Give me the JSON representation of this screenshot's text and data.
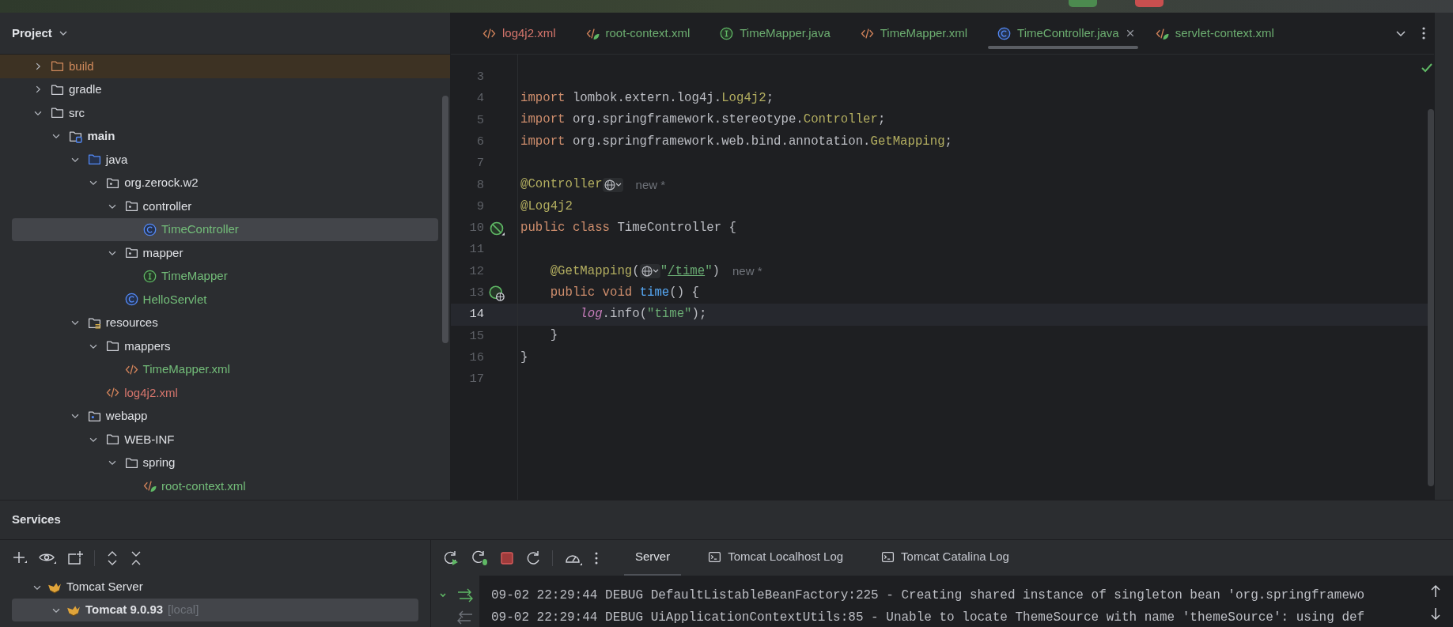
{
  "toolbar_buttons": [
    {
      "kind": "run"
    },
    {
      "kind": "stop"
    }
  ],
  "project": {
    "title": "Project",
    "tree": [
      {
        "label": "build",
        "kind": "excluded",
        "color": "#d08a5c",
        "expanded": false,
        "selected": false
      },
      {
        "label": "gradle",
        "kind": "folder",
        "color": "#dfe1e5",
        "expanded": false,
        "selected": false
      },
      {
        "label": "src",
        "kind": "folder",
        "color": "#dfe1e5",
        "expanded": true,
        "selected": false,
        "children": [
          {
            "label": "main",
            "kind": "module-root",
            "color": "#dfe1e5",
            "expanded": true,
            "selected": false,
            "children": [
              {
                "label": "java",
                "kind": "source-root",
                "color": "#dfe1e5",
                "expanded": true,
                "selected": false,
                "children": [
                  {
                    "label": "org.zerock.w2",
                    "kind": "package",
                    "color": "#dfe1e5",
                    "expanded": true,
                    "selected": false,
                    "children": [
                      {
                        "label": "controller",
                        "kind": "package",
                        "color": "#dfe1e5",
                        "expanded": true,
                        "selected": false,
                        "children": [
                          {
                            "label": "TimeController",
                            "kind": "class",
                            "color": "#73bd79",
                            "selected": true
                          }
                        ]
                      },
                      {
                        "label": "mapper",
                        "kind": "package",
                        "color": "#dfe1e5",
                        "expanded": true,
                        "selected": false,
                        "children": [
                          {
                            "label": "TimeMapper",
                            "kind": "interface",
                            "color": "#73bd79",
                            "selected": false
                          }
                        ]
                      },
                      {
                        "label": "HelloServlet",
                        "kind": "class",
                        "color": "#73bd79",
                        "selected": false
                      }
                    ]
                  }
                ]
              },
              {
                "label": "resources",
                "kind": "resources",
                "color": "#dfe1e5",
                "expanded": true,
                "selected": false,
                "children": [
                  {
                    "label": "mappers",
                    "kind": "folder",
                    "color": "#dfe1e5",
                    "expanded": true,
                    "selected": false,
                    "children": [
                      {
                        "label": "TimeMapper.xml",
                        "kind": "xml",
                        "color": "#73bd79",
                        "selected": false
                      }
                    ]
                  },
                  {
                    "label": "log4j2.xml",
                    "kind": "xml",
                    "color": "#d5756c",
                    "selected": false
                  }
                ]
              },
              {
                "label": "webapp",
                "kind": "webapp",
                "color": "#dfe1e5",
                "expanded": true,
                "selected": false,
                "children": [
                  {
                    "label": "WEB-INF",
                    "kind": "folder",
                    "color": "#dfe1e5",
                    "expanded": true,
                    "selected": false,
                    "children": [
                      {
                        "label": "spring",
                        "kind": "folder",
                        "color": "#dfe1e5",
                        "expanded": true,
                        "selected": false,
                        "children": [
                          {
                            "label": "root-context.xml",
                            "kind": "spring-xml",
                            "color": "#73bd79",
                            "selected": false
                          }
                        ]
                      }
                    ]
                  }
                ]
              }
            ]
          }
        ]
      }
    ]
  },
  "editor": {
    "tabs": [
      {
        "label": "log4j2.xml",
        "kind": "xml",
        "color": "#d5756c",
        "selected": false
      },
      {
        "label": "root-context.xml",
        "kind": "spring-xml",
        "color": "#6cad70",
        "selected": false
      },
      {
        "label": "TimeMapper.java",
        "kind": "interface",
        "color": "#6cad70",
        "selected": false
      },
      {
        "label": "TimeMapper.xml",
        "kind": "xml",
        "color": "#6cad70",
        "selected": false
      },
      {
        "label": "TimeController.java",
        "kind": "class",
        "color": "#6cad70",
        "selected": true
      },
      {
        "label": "servlet-context.xml",
        "kind": "spring-xml",
        "color": "#6cad70",
        "selected": false
      }
    ],
    "lines": [
      {
        "number": "3",
        "current": false
      },
      {
        "number": "4",
        "current": false,
        "segments": [
          {
            "kind": "keyword",
            "text": "import"
          },
          {
            "kind": "plain",
            "text": " lombok.extern.log4j."
          },
          {
            "kind": "type",
            "text": "Log4j2"
          },
          {
            "kind": "plain",
            "text": ";"
          }
        ]
      },
      {
        "number": "5",
        "current": false,
        "segments": [
          {
            "kind": "keyword",
            "text": "import"
          },
          {
            "kind": "plain",
            "text": " org.springframework.stereotype."
          },
          {
            "kind": "type",
            "text": "Controller"
          },
          {
            "kind": "plain",
            "text": ";"
          }
        ]
      },
      {
        "number": "6",
        "current": false,
        "segments": [
          {
            "kind": "keyword",
            "text": "import"
          },
          {
            "kind": "plain",
            "text": " org.springframework.web.bind.annotation."
          },
          {
            "kind": "type",
            "text": "GetMapping"
          },
          {
            "kind": "plain",
            "text": ";"
          }
        ]
      },
      {
        "number": "7",
        "current": false
      },
      {
        "number": "8",
        "current": false,
        "segments": [
          {
            "kind": "annotation",
            "text": "@Controller"
          },
          {
            "kind": "globe"
          },
          {
            "kind": "hint",
            "text": "new *"
          }
        ]
      },
      {
        "number": "9",
        "current": false,
        "segments": [
          {
            "kind": "annotation",
            "text": "@Log4j2"
          }
        ]
      },
      {
        "number": "10",
        "current": false,
        "gutter": {
          "kind": "bean"
        },
        "segments": [
          {
            "kind": "keyword",
            "text": "public class"
          },
          {
            "kind": "plain",
            "text": " TimeController {"
          }
        ]
      },
      {
        "number": "11",
        "current": false
      },
      {
        "number": "12",
        "current": false,
        "segments": [
          {
            "kind": "annotation",
            "text": "    @GetMapping"
          },
          {
            "kind": "plain",
            "text": "("
          },
          {
            "kind": "globe"
          },
          {
            "kind": "string",
            "text": "\""
          },
          {
            "kind": "url",
            "text": "/time"
          },
          {
            "kind": "string",
            "text": "\""
          },
          {
            "kind": "plain",
            "text": ")"
          },
          {
            "kind": "hint",
            "text": "new *"
          }
        ]
      },
      {
        "number": "13",
        "current": false,
        "gutter": {
          "kind": "web-bean"
        },
        "segments": [
          {
            "kind": "keyword",
            "text": "    public void"
          },
          {
            "kind": "method",
            "text": " time"
          },
          {
            "kind": "plain",
            "text": "() {"
          }
        ]
      },
      {
        "number": "14",
        "current": true,
        "segments": [
          {
            "kind": "field",
            "text": "        log"
          },
          {
            "kind": "plain",
            "text": ".info("
          },
          {
            "kind": "string",
            "text": "\"time\""
          },
          {
            "kind": "plain",
            "text": ");"
          }
        ]
      },
      {
        "number": "15",
        "current": false,
        "segments": [
          {
            "kind": "plain",
            "text": "    }"
          }
        ]
      },
      {
        "number": "16",
        "current": false,
        "segments": [
          {
            "kind": "plain",
            "text": "}"
          }
        ]
      },
      {
        "number": "17",
        "current": false
      }
    ]
  },
  "services": {
    "title": "Services",
    "tree": [
      {
        "label": "Tomcat Server",
        "expanded": true,
        "selected": false,
        "children": [
          {
            "label": "Tomcat 9.0.93",
            "note": "[local]",
            "expanded": true,
            "selected": true
          }
        ]
      }
    ],
    "tabs": [
      {
        "label": "Server",
        "kind": "plain",
        "selected": true
      },
      {
        "label": "Tomcat Localhost Log",
        "kind": "log",
        "selected": false
      },
      {
        "label": "Tomcat Catalina Log",
        "kind": "log",
        "selected": false
      }
    ],
    "log": [
      "09-02 22:29:44 DEBUG DefaultListableBeanFactory:225 - Creating shared instance of singleton bean 'org.springframewo",
      "09-02 22:29:44 DEBUG UiApplicationContextUtils:85 - Unable to locate ThemeSource with name 'themeSource': using def"
    ]
  }
}
